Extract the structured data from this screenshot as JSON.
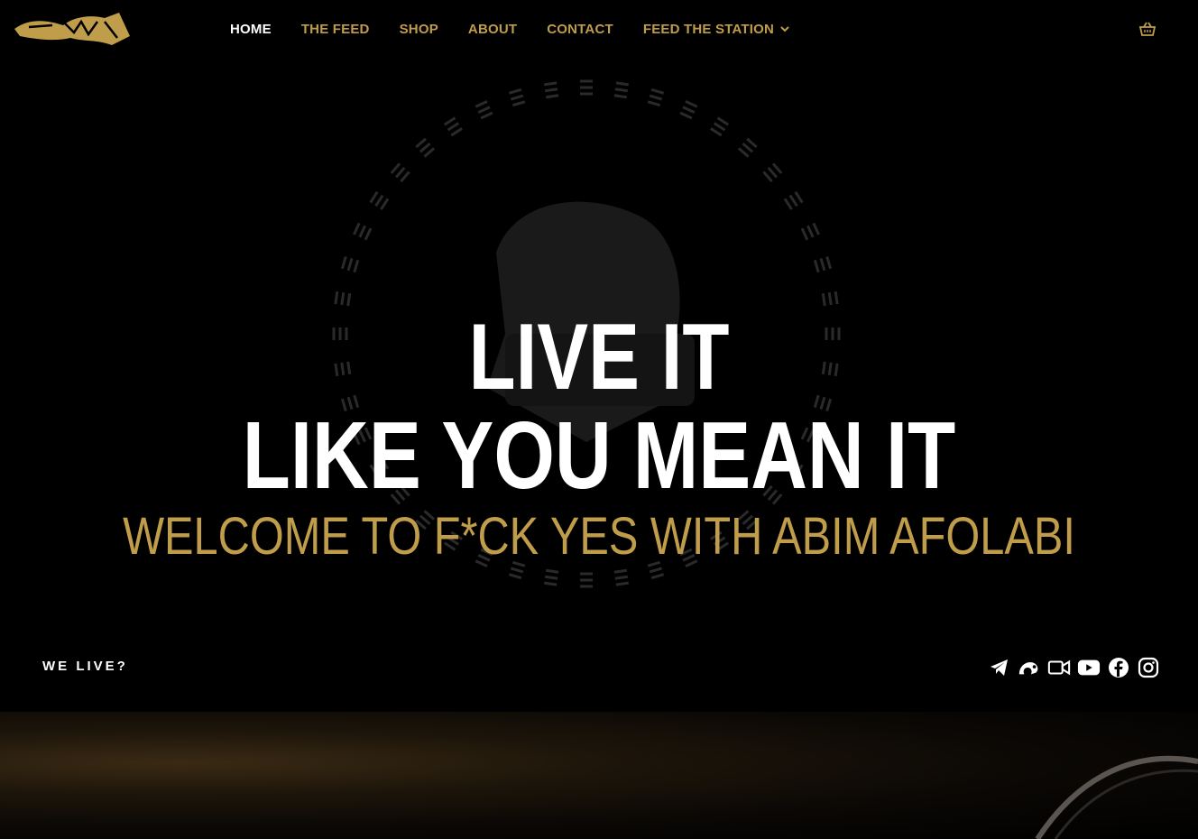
{
  "brand": {
    "logo_name": "graffiti-tag-logo",
    "accent_color": "#bf9d4a"
  },
  "nav": {
    "items": [
      {
        "label": "HOME",
        "active": true
      },
      {
        "label": "THE FEED",
        "active": false
      },
      {
        "label": "SHOP",
        "active": false
      },
      {
        "label": "ABOUT",
        "active": false
      },
      {
        "label": "CONTACT",
        "active": false
      },
      {
        "label": "FEED THE STATION",
        "active": false,
        "has_dropdown": true
      }
    ],
    "cart_icon": "shopping-basket-icon"
  },
  "hero": {
    "line1": "LIVE IT",
    "line2": "LIKE YOU MEAN IT",
    "welcome": "WELCOME TO F*CK YES WITH ABIM AFOLABI",
    "background_art": "podcast-microphone-sound-ring"
  },
  "footer_bar": {
    "we_live": "WE LIVE?",
    "socials": [
      "telegram-icon",
      "rumble-icon",
      "video-camera-icon",
      "youtube-icon",
      "facebook-icon",
      "instagram-icon"
    ]
  }
}
